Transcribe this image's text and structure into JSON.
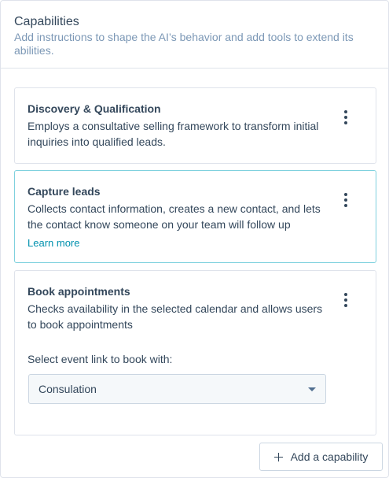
{
  "panel": {
    "title": "Capabilities",
    "description": "Add instructions to shape the AI’s behavior and add tools to extend its abilities."
  },
  "capabilities": [
    {
      "title": "Discovery & Qualification",
      "description": "Employs a consultative selling framework to transform initial inquiries into qualified leads."
    },
    {
      "title": "Capture leads",
      "description": "Collects contact information, creates a new contact, and lets the contact know someone on your team will follow up",
      "link": "Learn more"
    },
    {
      "title": "Book appointments",
      "description": "Checks availability in the selected calendar and allows users to book appointments",
      "field_label": "Select event link to book with:",
      "select_value": "Consulation"
    }
  ],
  "footer": {
    "add_label": "Add a capability"
  },
  "colors": {
    "text": "#33475b",
    "muted": "#7c98b6",
    "link": "#0091ae",
    "border": "#dfe3eb",
    "selected_border": "#7fd1de"
  }
}
